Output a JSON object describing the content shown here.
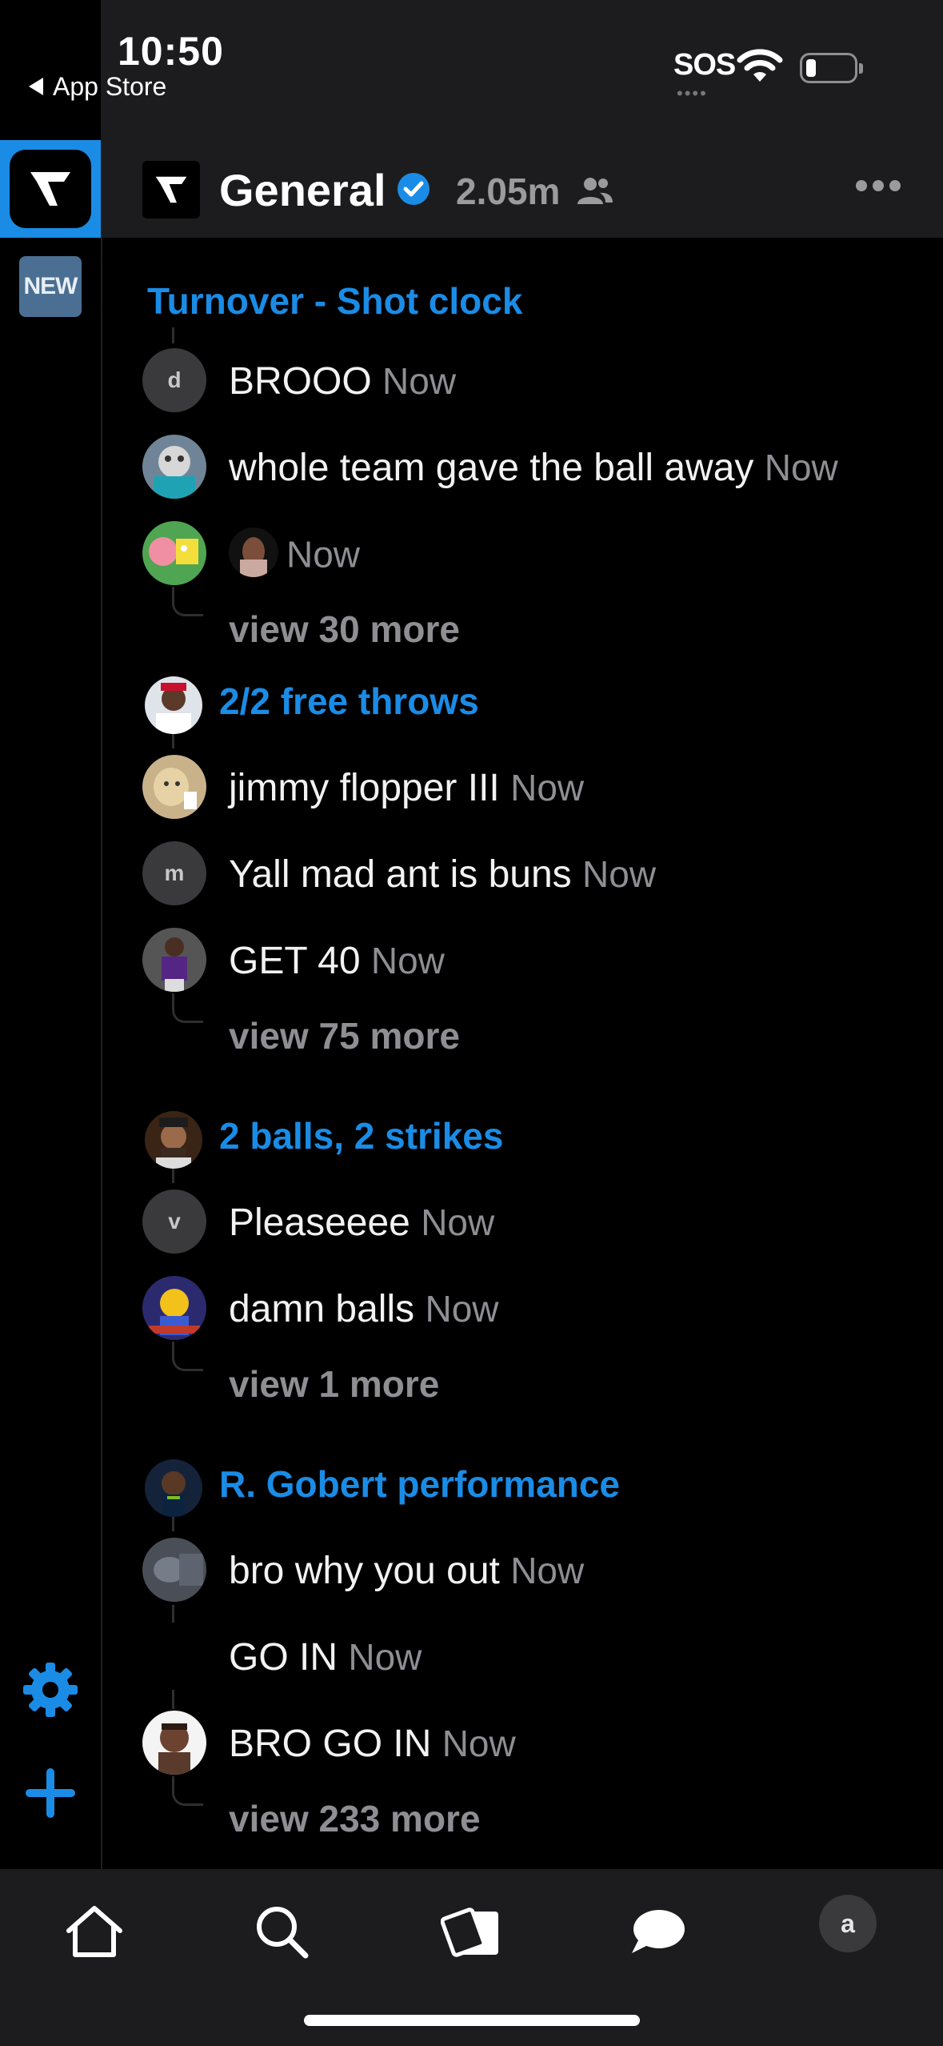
{
  "status_bar": {
    "time": "10:50",
    "back_label": "App Store",
    "sos": "SOS"
  },
  "rail": {
    "new_badge": "NEW"
  },
  "channel": {
    "name": "General",
    "member_count": "2.05m"
  },
  "colors": {
    "accent": "#1a8ce6",
    "muted": "#8e8e93",
    "background": "#000000"
  },
  "threads": [
    {
      "title": "Turnover - Shot clock",
      "messages": [
        {
          "avatar_letter": "d",
          "text": "BROOO",
          "time": "Now"
        },
        {
          "avatar_letter": "",
          "text": "whole team gave the ball away",
          "time": "Now"
        },
        {
          "avatar_letter": "",
          "text": "",
          "time": "Now"
        }
      ],
      "view_more": "view 30 more"
    },
    {
      "title": "2/2 free throws",
      "messages": [
        {
          "avatar_letter": "",
          "text": "jimmy flopper III",
          "time": "Now"
        },
        {
          "avatar_letter": "m",
          "text": "Yall mad ant is buns",
          "time": "Now"
        },
        {
          "avatar_letter": "",
          "text": "GET 40",
          "time": "Now"
        }
      ],
      "view_more": "view 75 more"
    },
    {
      "title": "2 balls, 2 strikes",
      "messages": [
        {
          "avatar_letter": "v",
          "text": "Pleaseeee",
          "time": "Now"
        },
        {
          "avatar_letter": "",
          "text": "damn balls",
          "time": "Now"
        }
      ],
      "view_more": "view 1 more"
    },
    {
      "title": "R. Gobert performance",
      "messages": [
        {
          "avatar_letter": "",
          "text": "bro why you out",
          "time": "Now"
        },
        {
          "avatar_letter": "",
          "text": "GO IN",
          "time": "Now"
        },
        {
          "avatar_letter": "",
          "text": "BRO GO IN",
          "time": "Now"
        }
      ],
      "view_more": "view 233 more"
    }
  ],
  "tabbar": {
    "profile_letter": "a"
  }
}
